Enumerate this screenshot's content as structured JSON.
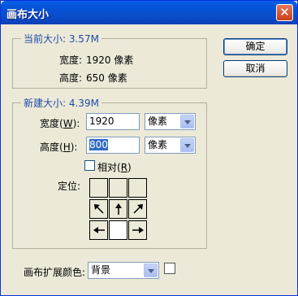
{
  "window": {
    "title": "画布大小",
    "close_label": "✕"
  },
  "buttons": {
    "ok": "确定",
    "cancel": "取消"
  },
  "current_size": {
    "heading": "当前大小: 3.57M",
    "width_label": "宽度:",
    "width_value": "1920 像素",
    "height_label": "高度:",
    "height_value": "650 像素"
  },
  "new_size": {
    "heading": "新建大小: 4.39M",
    "width_label_pre": "宽度(",
    "width_label_key": "W",
    "width_label_post": "):",
    "width_value": "1920",
    "width_unit": "像素",
    "height_label_pre": "高度(",
    "height_label_key": "H",
    "height_label_post": "):",
    "height_value": "800",
    "height_unit": "像素",
    "relative_pre": "相对(",
    "relative_key": "R",
    "relative_post": ")",
    "relative_checked": false,
    "anchor_label": "定位:"
  },
  "extension_color": {
    "label": "画布扩展颜色:",
    "value": "背景"
  },
  "icons": [
    "close-icon",
    "arrow-up-left-icon",
    "arrow-up-icon",
    "arrow-up-right-icon",
    "arrow-left-icon",
    "arrow-right-icon",
    "dropdown-arrow-icon"
  ]
}
